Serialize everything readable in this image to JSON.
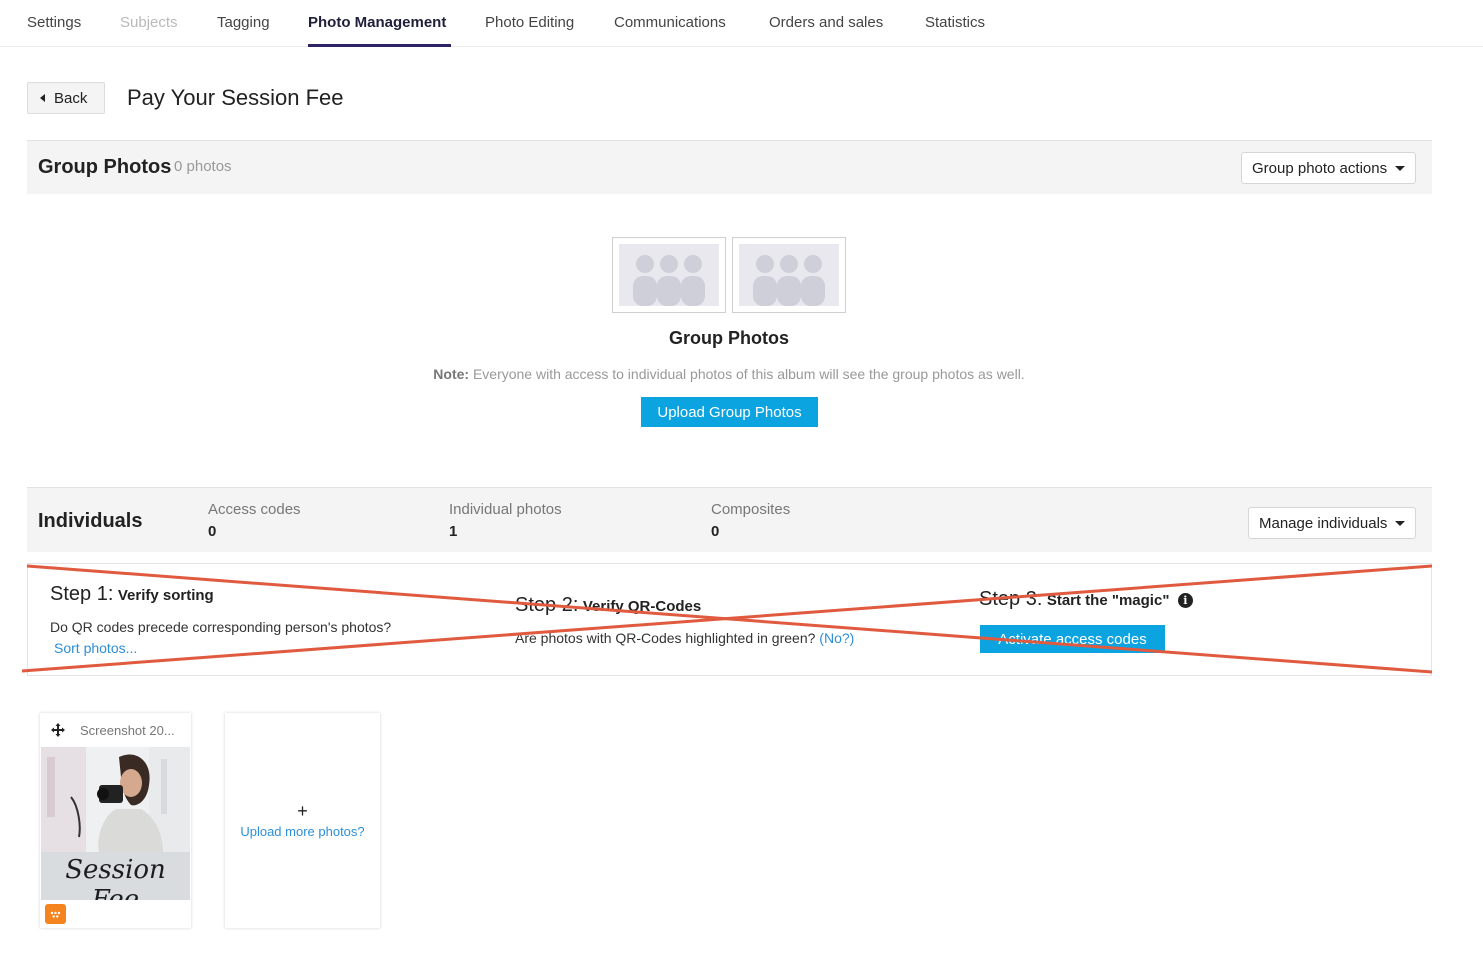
{
  "nav": {
    "tabs": [
      {
        "label": "Settings",
        "state": "normal"
      },
      {
        "label": "Subjects",
        "state": "disabled"
      },
      {
        "label": "Tagging",
        "state": "normal"
      },
      {
        "label": "Photo Management",
        "state": "active"
      },
      {
        "label": "Photo Editing",
        "state": "normal"
      },
      {
        "label": "Communications",
        "state": "normal"
      },
      {
        "label": "Orders and sales",
        "state": "normal"
      },
      {
        "label": "Statistics",
        "state": "normal"
      }
    ]
  },
  "header": {
    "back_label": "Back",
    "title": "Pay Your Session Fee"
  },
  "group_photos": {
    "title": "Group Photos",
    "count": "0 photos",
    "actions_label": "Group photo actions",
    "empty_title": "Group Photos",
    "note_label": "Note:",
    "note_text": " Everyone with access to individual photos of this album will see the group photos as well.",
    "upload_label": "Upload Group Photos"
  },
  "individuals": {
    "title": "Individuals",
    "stats": [
      {
        "label": "Access codes",
        "value": "0"
      },
      {
        "label": "Individual photos",
        "value": "1"
      },
      {
        "label": "Composites",
        "value": "0"
      }
    ],
    "manage_label": "Manage individuals"
  },
  "steps": {
    "step1": {
      "prefix": "Step 1:",
      "title": "Verify sorting",
      "text": "Do QR codes precede corresponding person's photos?",
      "link": "Sort photos..."
    },
    "step2": {
      "prefix": "Step 2:",
      "title": "Verify QR-Codes",
      "text": "Are photos with QR-Codes highlighted in green?",
      "link": "(No?)"
    },
    "step3": {
      "prefix": "Step 3:",
      "title": "Start the \"magic\"",
      "info": "i",
      "button": "Activate access codes"
    }
  },
  "photos": {
    "items": [
      {
        "filename": "Screenshot 20...",
        "overlay_text": "Session Fee"
      }
    ],
    "upload_plus": "+",
    "upload_more": "Upload more photos?"
  },
  "colors": {
    "accent": "#0ca4e0",
    "nav_active": "#2d2466",
    "cross_line": "#e05a3f",
    "badge": "#f5841f",
    "link": "#2d8fd6"
  }
}
